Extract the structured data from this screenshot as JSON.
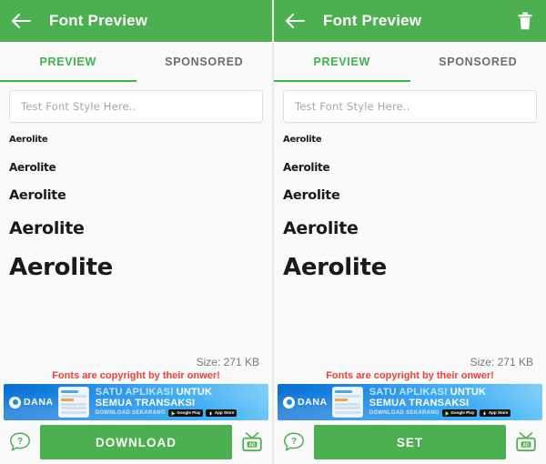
{
  "theme": {
    "primary_green": "#4caf50",
    "tab_active_green": "#3bb54a",
    "copyright_red": "#f0403a",
    "ad_blue": "#108ee9"
  },
  "panels": [
    {
      "appbar": {
        "back_icon": "back-arrow-icon",
        "title": "Font Preview",
        "has_delete": false,
        "delete_icon": "trash-icon"
      },
      "tabs": [
        {
          "label": "PREVIEW",
          "active": true
        },
        {
          "label": "SPONSORED",
          "active": false
        }
      ],
      "search": {
        "value": "",
        "placeholder": "Test Font Style Here.."
      },
      "samples": [
        "Aerolite",
        "Aerolite",
        "Aerolite",
        "Aerolite",
        "Aerolite"
      ],
      "size_label": "Size: 271 KB",
      "copyright": "Fonts are copyright by their onwer!",
      "ad": {
        "brand": "DANA",
        "line1_a": "SATU APLIKASI ",
        "line1_b": "UNTUK",
        "line2": "SEMUA TRANSAKSI",
        "cta": "DOWNLOAD SEKARANG",
        "badge_google": "Google Play",
        "badge_apple": "App Store"
      },
      "bottom": {
        "help_icon": "help-question-bubble-icon",
        "action_label": "DOWNLOAD",
        "ad_icon": "tv-ad-icon",
        "ad_icon_label": "AD"
      }
    },
    {
      "appbar": {
        "back_icon": "back-arrow-icon",
        "title": "Font Preview",
        "has_delete": true,
        "delete_icon": "trash-icon"
      },
      "tabs": [
        {
          "label": "PREVIEW",
          "active": true
        },
        {
          "label": "SPONSORED",
          "active": false
        }
      ],
      "search": {
        "value": "",
        "placeholder": "Test Font Style Here.."
      },
      "samples": [
        "Aerolite",
        "Aerolite",
        "Aerolite",
        "Aerolite",
        "Aerolite"
      ],
      "size_label": "Size: 271 KB",
      "copyright": "Fonts are copyright by their onwer!",
      "ad": {
        "brand": "DANA",
        "line1_a": "SATU APLIKASI ",
        "line1_b": "UNTUK",
        "line2": "SEMUA TRANSAKSI",
        "cta": "DOWNLOAD SEKARANG",
        "badge_google": "Google Play",
        "badge_apple": "App Store"
      },
      "bottom": {
        "help_icon": "help-question-bubble-icon",
        "action_label": "SET",
        "ad_icon": "tv-ad-icon",
        "ad_icon_label": "AD"
      }
    }
  ]
}
